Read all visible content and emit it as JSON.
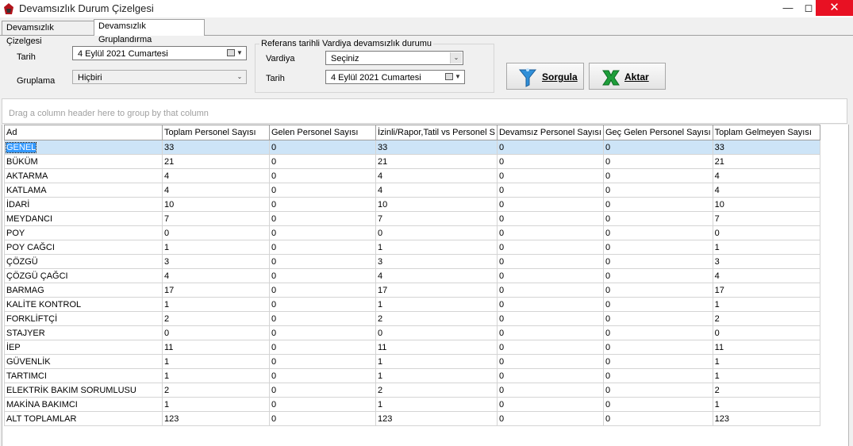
{
  "window": {
    "title": "Devamsızlık Durum Çizelgesi"
  },
  "tabs": [
    {
      "label": "Devamsızlık Çizelgesi"
    },
    {
      "label": "Devamsızlık Gruplandırma"
    }
  ],
  "filters": {
    "tarih_label": "Tarih",
    "tarih_value": "4   Eylül   2021 Cumartesi",
    "gruplama_label": "Gruplama",
    "gruplama_value": "Hiçbiri",
    "group_title": "Referans tarihli Vardiya devamsızlık durumu",
    "vardiya_label": "Vardiya",
    "vardiya_value": "Seçiniz",
    "ref_tarih_label": "Tarih",
    "ref_tarih_value": "4   Eylül   2021 Cumartesi"
  },
  "buttons": {
    "sorgula": "Sorgula",
    "aktar": "Aktar"
  },
  "groupbar_text": "Drag a column header here to group by that column",
  "columns": [
    "Ad",
    "Toplam Personel  Sayısı",
    "Gelen Personel Sayısı",
    "İzinli/Rapor,Tatil vs Personel S",
    "Devamsız Personel Sayısı",
    "Geç Gelen Personel Sayısı",
    "Toplam Gelmeyen Sayısı"
  ],
  "rows": [
    [
      "GENEL",
      "33",
      "0",
      "33",
      "0",
      "0",
      "33"
    ],
    [
      "BÜKÜM",
      "21",
      "0",
      "21",
      "0",
      "0",
      "21"
    ],
    [
      "AKTARMA",
      "4",
      "0",
      "4",
      "0",
      "0",
      "4"
    ],
    [
      "KATLAMA",
      "4",
      "0",
      "4",
      "0",
      "0",
      "4"
    ],
    [
      "İDARİ",
      "10",
      "0",
      "10",
      "0",
      "0",
      "10"
    ],
    [
      "MEYDANCI",
      "7",
      "0",
      "7",
      "0",
      "0",
      "7"
    ],
    [
      "POY",
      "0",
      "0",
      "0",
      "0",
      "0",
      "0"
    ],
    [
      "POY CAĞCI",
      "1",
      "0",
      "1",
      "0",
      "0",
      "1"
    ],
    [
      "ÇÖZGÜ",
      "3",
      "0",
      "3",
      "0",
      "0",
      "3"
    ],
    [
      "ÇÖZGÜ ÇAĞCI",
      "4",
      "0",
      "4",
      "0",
      "0",
      "4"
    ],
    [
      "BARMAG",
      "17",
      "0",
      "17",
      "0",
      "0",
      "17"
    ],
    [
      "KALİTE KONTROL",
      "1",
      "0",
      "1",
      "0",
      "0",
      "1"
    ],
    [
      "FORKLİFTÇİ",
      "2",
      "0",
      "2",
      "0",
      "0",
      "2"
    ],
    [
      "STAJYER",
      "0",
      "0",
      "0",
      "0",
      "0",
      "0"
    ],
    [
      "İEP",
      "11",
      "0",
      "11",
      "0",
      "0",
      "11"
    ],
    [
      "GÜVENLİK",
      "1",
      "0",
      "1",
      "0",
      "0",
      "1"
    ],
    [
      "TARTIMCI",
      "1",
      "0",
      "1",
      "0",
      "0",
      "1"
    ],
    [
      "ELEKTRİK BAKIM SORUMLUSU",
      "2",
      "0",
      "2",
      "0",
      "0",
      "2"
    ],
    [
      "MAKİNA BAKIMCI",
      "1",
      "0",
      "1",
      "0",
      "0",
      "1"
    ],
    [
      "ALT TOPLAMLAR",
      "123",
      "0",
      "123",
      "0",
      "0",
      "123"
    ]
  ]
}
